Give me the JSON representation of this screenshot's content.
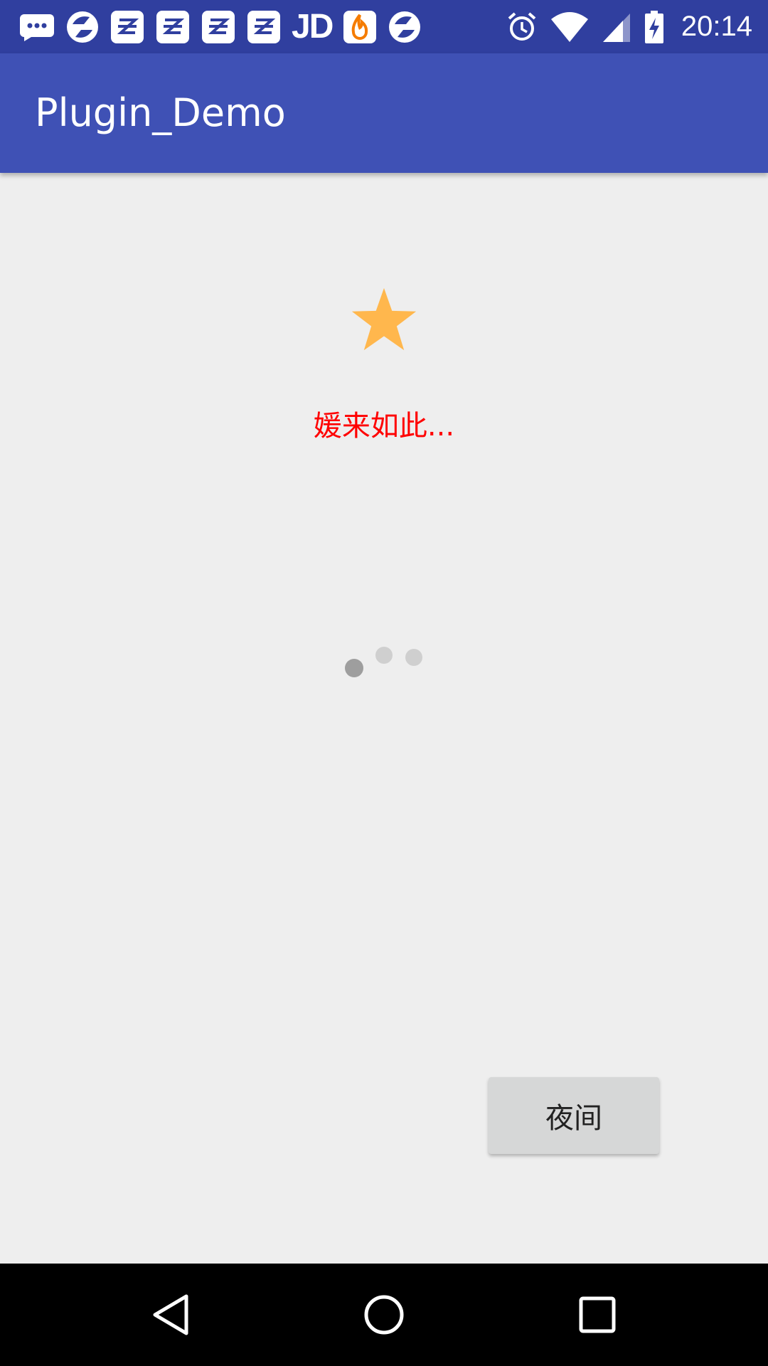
{
  "status_bar": {
    "left_icons": [
      "messages-icon",
      "sync-app-icon",
      "zhihu-icon",
      "zhihu-icon",
      "zhihu-icon",
      "zhihu-icon",
      "jd-icon",
      "fire-app-icon",
      "sync-app-icon"
    ],
    "jd_label": "JD",
    "right_icons": [
      "alarm-icon",
      "wifi-icon",
      "cell-signal-icon",
      "battery-charging-icon"
    ],
    "time": "20:14",
    "background_color": "#303f9f"
  },
  "app_bar": {
    "title": "Plugin_Demo",
    "background_color": "#3f51b5"
  },
  "main": {
    "icon": "star-icon",
    "icon_color": "#ffb74d",
    "message": "媛来如此...",
    "message_color": "#ff0000",
    "spinner": "loading-dots-icon",
    "night_button_label": "夜间"
  },
  "nav_bar": {
    "buttons": [
      "back-icon",
      "home-icon",
      "recents-icon"
    ]
  }
}
